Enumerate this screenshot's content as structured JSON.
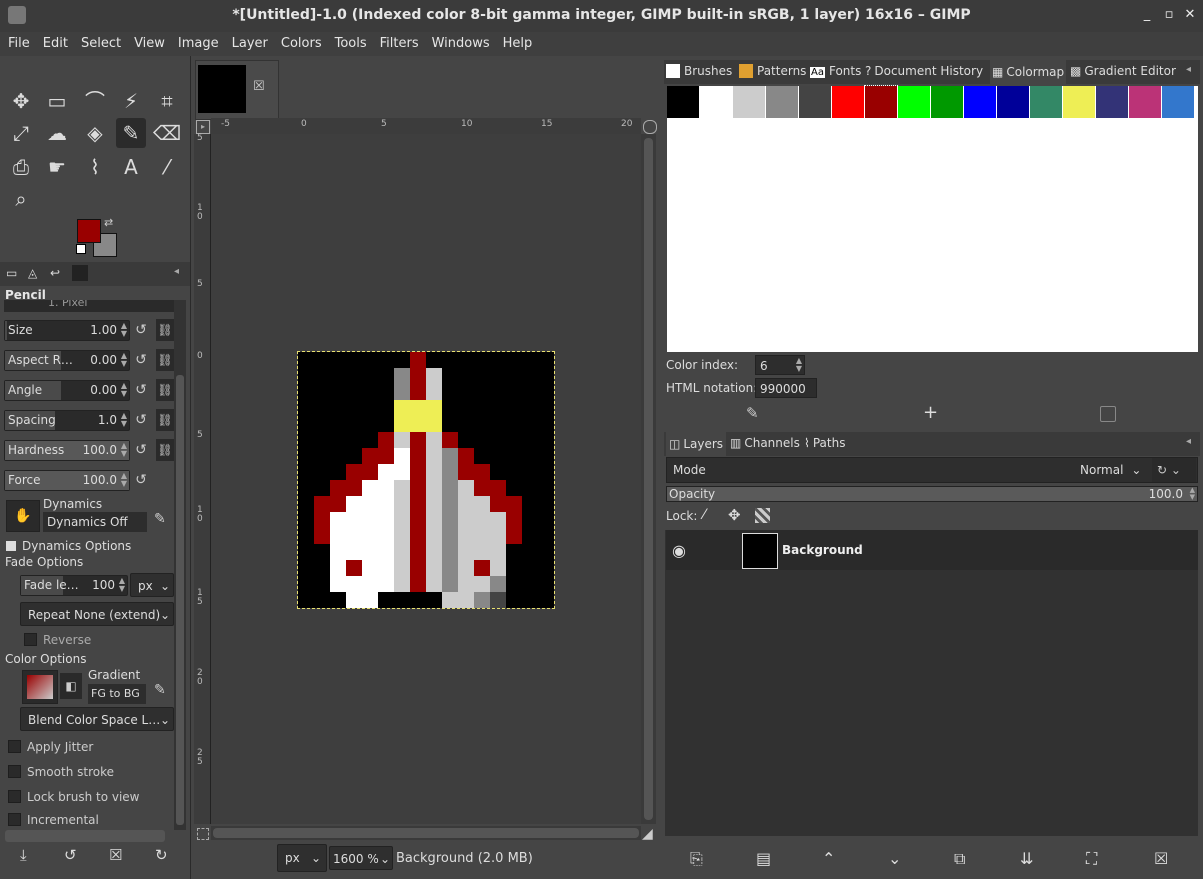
{
  "window": {
    "title": "*[Untitled]-1.0 (Indexed color 8-bit gamma integer, GIMP built-in sRGB, 1 layer) 16x16 – GIMP",
    "minimize": "_",
    "restore": "▫",
    "close": "✕"
  },
  "menu": [
    "File",
    "Edit",
    "Select",
    "View",
    "Image",
    "Layer",
    "Colors",
    "Tools",
    "Filters",
    "Windows",
    "Help"
  ],
  "toolbox": {
    "tools": [
      {
        "name": "move-tool",
        "glyph": "✥"
      },
      {
        "name": "rect-select-tool",
        "glyph": "▭"
      },
      {
        "name": "lasso-tool",
        "glyph": "⌒"
      },
      {
        "name": "fuzzy-select-tool",
        "glyph": "⚡"
      },
      {
        "name": "crop-tool",
        "glyph": "⌗"
      },
      {
        "name": "transform-tool",
        "glyph": "⤢"
      },
      {
        "name": "warp-tool",
        "glyph": "☁"
      },
      {
        "name": "bucket-fill-tool",
        "glyph": "◈"
      },
      {
        "name": "pencil-tool",
        "glyph": "✎"
      },
      {
        "name": "eraser-tool",
        "glyph": "⌫"
      },
      {
        "name": "clone-tool",
        "glyph": "⎙"
      },
      {
        "name": "smudge-tool",
        "glyph": "☛"
      },
      {
        "name": "path-tool",
        "glyph": "⌇"
      },
      {
        "name": "text-tool",
        "glyph": "A"
      },
      {
        "name": "color-picker-tool",
        "glyph": "⁄"
      },
      {
        "name": "zoom-tool",
        "glyph": "⌕"
      }
    ],
    "fg_color": "#990000",
    "bg_color": "#888888"
  },
  "tool_options": {
    "title": "Pencil",
    "brush_name": "1. Pixel",
    "size": {
      "label": "Size",
      "value": "1.00"
    },
    "aspect": {
      "label": "Aspect R…",
      "value": "0.00"
    },
    "angle": {
      "label": "Angle",
      "value": "0.00"
    },
    "spacing": {
      "label": "Spacing",
      "value": "1.0"
    },
    "hardness": {
      "label": "Hardness",
      "value": "100.0"
    },
    "force": {
      "label": "Force",
      "value": "100.0"
    },
    "dynamics_label": "Dynamics",
    "dynamics_value": "Dynamics Off",
    "dynamics_options": "Dynamics Options",
    "fade_options": "Fade Options",
    "fade_length": {
      "label": "Fade le…",
      "value": "100"
    },
    "fade_unit": "px",
    "repeat": "Repeat  None (extend)",
    "reverse": "Reverse",
    "color_options": "Color Options",
    "gradient_label": "Gradient",
    "gradient_value": "FG to BG",
    "blend_space": "Blend Color Space L…",
    "apply_jitter": "Apply Jitter",
    "smooth_stroke": "Smooth stroke",
    "lock_brush": "Lock brush to view",
    "incremental": "Incremental"
  },
  "canvas": {
    "ruler_h": [
      "-5",
      "0",
      "5",
      "10",
      "15",
      "20"
    ],
    "ruler_v": [
      "5",
      "1\n0",
      "5",
      "0",
      "5",
      "1\n0",
      "1\n5",
      "2\n0",
      "2\n5"
    ],
    "unit": "px",
    "zoom": "1600 %",
    "status": "Background (2.0 MB)"
  },
  "right_tabs": [
    "Brushes",
    "Patterns",
    "Fonts",
    "Document History",
    "Colormap",
    "Gradient Editor"
  ],
  "colormap": {
    "swatches": [
      "#000000",
      "#ffffff",
      "#cccccc",
      "#888888",
      "#444444",
      "#ff0000",
      "#990000",
      "#00ff00",
      "#009900",
      "#0000ff",
      "#000099",
      "#338866",
      "#eeee55",
      "#333377",
      "#bb3377",
      "#3377cc"
    ],
    "color_index_label": "Color index:",
    "color_index_value": "6",
    "html_label": "HTML notation:",
    "html_value": "990000"
  },
  "layers": {
    "tabs": [
      "Layers",
      "Channels",
      "Paths"
    ],
    "mode_label": "Mode",
    "mode_value": "Normal",
    "opacity_label": "Opacity",
    "opacity_value": "100.0",
    "lock_label": "Lock:",
    "layer_name": "Background"
  }
}
